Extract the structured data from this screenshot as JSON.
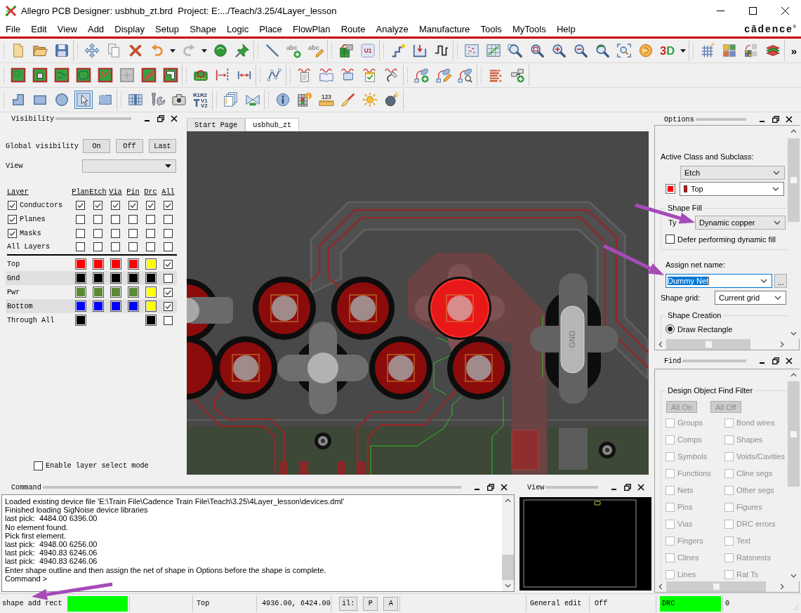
{
  "window": {
    "title": "Allegro PCB Designer: usbhub_zt.brd  Project: E:.../Teach/3.25/4Layer_lesson",
    "logo": "cādence$^{®}$"
  },
  "menu": [
    "File",
    "Edit",
    "View",
    "Add",
    "Display",
    "Setup",
    "Shape",
    "Logic",
    "Place",
    "FlowPlan",
    "Route",
    "Analyze",
    "Manufacture",
    "Tools",
    "MyTools",
    "Help"
  ],
  "toolbar_texts": {
    "text_add": "abc",
    "text_edit": "abc",
    "component": "U1",
    "three_d": "3D",
    "ref_des": [
      "R1R2",
      "V1",
      "V2"
    ],
    "ruler": "123",
    "overflow": "»"
  },
  "pointer_tool": {
    "selected": true
  },
  "visibility": {
    "title": "Visibility",
    "global_label": "Global visibility",
    "global_buttons": [
      "On",
      "Off",
      "Last"
    ],
    "view_label": "View",
    "columns": [
      "Layer",
      "Plan",
      "Etch",
      "Via",
      "Pin",
      "Drc",
      "All"
    ],
    "groups": [
      {
        "name": "Conductors",
        "checked": true,
        "cells": [
          true,
          true,
          true,
          true,
          true,
          true
        ]
      },
      {
        "name": "Planes",
        "checked": true,
        "cells": [
          false,
          false,
          false,
          false,
          false,
          false
        ]
      },
      {
        "name": "Masks",
        "checked": true,
        "cells": [
          false,
          false,
          false,
          false,
          false,
          false
        ]
      }
    ],
    "all_layers": {
      "name": "All Layers",
      "cells": [
        false,
        false,
        false,
        false,
        false,
        false
      ]
    },
    "layers": [
      {
        "name": "Top",
        "plan": {
          "color": "#ff0000"
        },
        "etch": {
          "color": "#ff0000"
        },
        "via": {
          "color": "#ff0000"
        },
        "pin": {
          "color": "#ff0000"
        },
        "drc": {
          "color": "#ffff00"
        },
        "checked": true
      },
      {
        "name": "Gnd",
        "plan": {
          "color": "#000000"
        },
        "etch": {
          "color": "#000000"
        },
        "via": {
          "color": "#000000"
        },
        "pin": {
          "color": "#000000"
        },
        "drc": {
          "color": "#000000"
        },
        "checked": false
      },
      {
        "name": "Pwr",
        "plan": {
          "color": "#5b8a35"
        },
        "etch": {
          "color": "#5b8a35"
        },
        "via": {
          "color": "#5b8a35"
        },
        "pin": {
          "color": "#5b8a35"
        },
        "drc": {
          "color": "#ffff00"
        },
        "checked": true
      },
      {
        "name": "Bottom",
        "plan": {
          "color": "#0000ff"
        },
        "etch": {
          "color": "#0000ff"
        },
        "via": {
          "color": "#0000ff"
        },
        "pin": {
          "color": "#0000ff"
        },
        "drc": {
          "color": "#ffff00"
        },
        "checked": true
      },
      {
        "name": "Through All",
        "plan": {
          "color": "#000000"
        },
        "drc": {
          "color": "#000000"
        },
        "checked": false
      }
    ],
    "enable_select": {
      "label": "Enable layer select mode",
      "checked": false
    }
  },
  "tabs": [
    {
      "label": "Start Page",
      "selected": false
    },
    {
      "label": "usbhub_zt",
      "selected": true
    }
  ],
  "canvas": {
    "pad_label": "GND"
  },
  "options": {
    "title": "Options",
    "class_label": "Active Class and Subclass:",
    "class_value": "Etch",
    "subclass": {
      "value": "Top",
      "color": "#ff0000"
    },
    "fill_group": "Shape Fill",
    "type_label": "Ty",
    "fill_type": "Dynamic copper",
    "defer": {
      "label": "Defer performing dynamic fill",
      "checked": false
    },
    "net_label": "Assign net name:",
    "net": {
      "value": "Dummy Net",
      "highlighted": true
    },
    "browse": "...",
    "grid_label": "Shape grid:",
    "grid_value": "Current grid",
    "creation_group": "Shape Creation",
    "creation": [
      {
        "label": "Draw Rectangle",
        "selected": true
      }
    ]
  },
  "find": {
    "title": "Find",
    "group": "Design Object Find Filter",
    "buttons": [
      {
        "label": "All On",
        "disabled": true
      },
      {
        "label": "All Off",
        "disabled": true
      }
    ],
    "items": [
      {
        "label": "Groups",
        "checked": false,
        "disabled": true
      },
      {
        "label": "Bond wires",
        "checked": false,
        "disabled": true
      },
      {
        "label": "Comps",
        "checked": false,
        "disabled": true
      },
      {
        "label": "Shapes",
        "checked": false,
        "disabled": true
      },
      {
        "label": "Symbols",
        "checked": false,
        "disabled": true
      },
      {
        "label": "Voids/Cavities",
        "checked": false,
        "disabled": true
      },
      {
        "label": "Functions",
        "checked": false,
        "disabled": true
      },
      {
        "label": "Cline segs",
        "checked": false,
        "disabled": true
      },
      {
        "label": "Nets",
        "checked": false,
        "disabled": true
      },
      {
        "label": "Other segs",
        "checked": false,
        "disabled": true
      },
      {
        "label": "Pins",
        "checked": false,
        "disabled": true
      },
      {
        "label": "Figures",
        "checked": false,
        "disabled": true
      },
      {
        "label": "Vias",
        "checked": false,
        "disabled": true
      },
      {
        "label": "DRC errors",
        "checked": false,
        "disabled": true
      },
      {
        "label": "Fingers",
        "checked": false,
        "disabled": true
      },
      {
        "label": "Text",
        "checked": false,
        "disabled": true
      },
      {
        "label": "Clines",
        "checked": false,
        "disabled": true
      },
      {
        "label": "Ratsnests",
        "checked": false,
        "disabled": true
      },
      {
        "label": "Lines",
        "checked": false,
        "disabled": true
      },
      {
        "label": "Rat Ts",
        "checked": false,
        "disabled": true
      }
    ]
  },
  "command": {
    "title": "Command",
    "lines": [
      "Loaded existing device file 'E:\\Train File\\Cadence Train File\\Teach\\3.25\\4Layer_lesson\\devices.dml'",
      "Finished loading SigNoise device libraries",
      "last pick:  4484.00 6396.00",
      "No element found.",
      "Pick first element.",
      "last pick:  4948.00 6256.00",
      "last pick:  4940.83 6246.06",
      "last pick:  4940.83 6246.06",
      "Enter shape outline and then assign the net of shape in Options before the shape is complete.",
      "Command >"
    ]
  },
  "view": {
    "title": "View"
  },
  "status": {
    "mode": "shape add rect",
    "layer": "Top",
    "coords": "4936.00, 6424.00",
    "buttons": [
      "il:",
      "P",
      "A"
    ],
    "edit_mode": "General edit",
    "state": "Off",
    "drc": "DRC",
    "drc_count": "0"
  }
}
